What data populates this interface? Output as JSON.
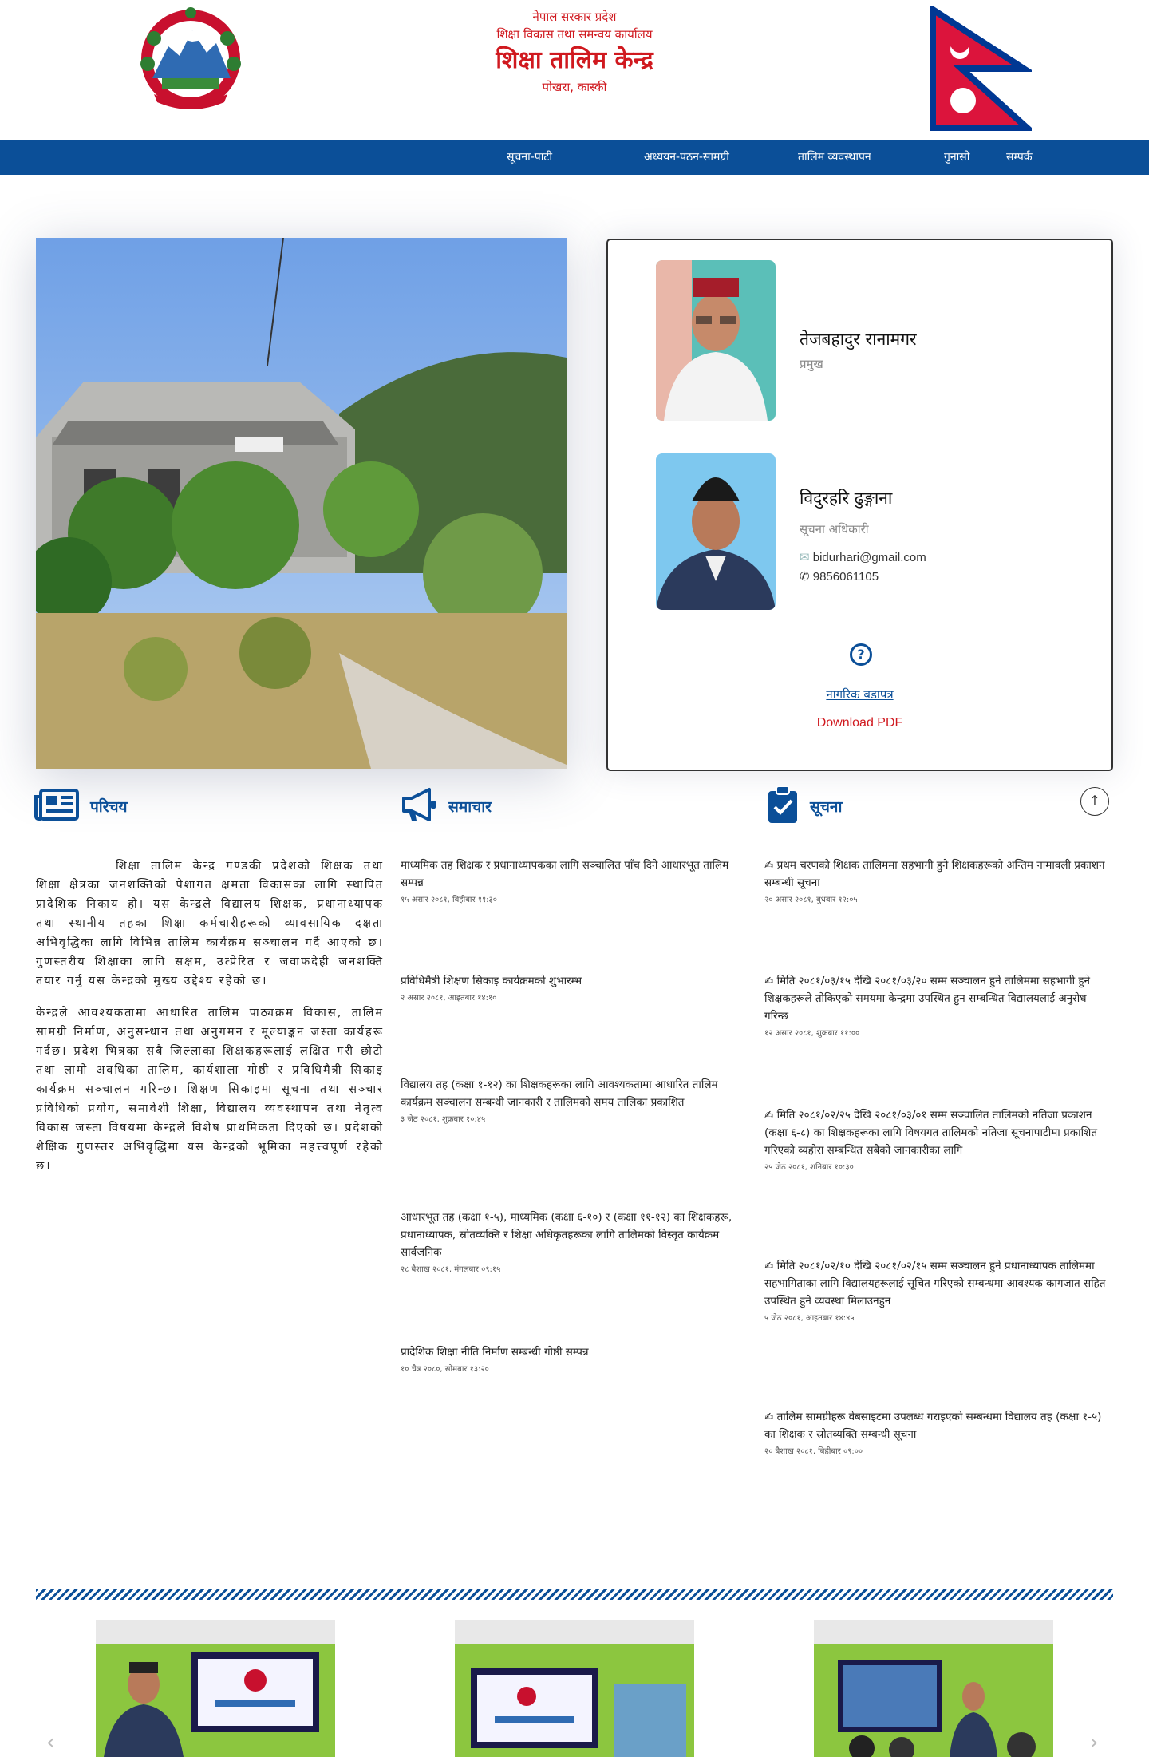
{
  "header": {
    "line1": "नेपाल सरकार प्रदेश",
    "line2": "शिक्षा विकास तथा समन्वय कार्यालय",
    "title": "शिक्षा तालिम केन्द्र",
    "location": "पोखरा, कास्की",
    "emblem_icon": "nepal-emblem",
    "flag_icon": "nepal-flag",
    "colors": {
      "brand_red": "#d0191f",
      "nav_blue": "#0b4f98"
    }
  },
  "nav": {
    "items": [
      {
        "label": "सूचना-पाटी"
      },
      {
        "label": "अध्ययन-पठन-सामग्री"
      },
      {
        "label": "तालिम व्यवस्थापन"
      },
      {
        "label": "गुनासो"
      },
      {
        "label": "सम्पर्क"
      }
    ]
  },
  "staff": {
    "members": [
      {
        "name": "तेजबहादुर रानामगर",
        "role": "प्रमुख"
      },
      {
        "name": "विदुरहरि ढुङ्गाना",
        "role": "सूचना अधिकारी",
        "email": "bidurhari@gmail.com",
        "phone": "9856061105",
        "email_icon": "envelope-icon",
        "phone_icon": "phone-icon"
      }
    ],
    "citizen_charter": "नागरिक बडापत्र",
    "download": "Download PDF"
  },
  "sections": {
    "intro": {
      "title": "परिचय",
      "icon": "newspaper-icon"
    },
    "news": {
      "title": "समाचार",
      "icon": "megaphone-icon"
    },
    "notices": {
      "title": "सूचना",
      "icon": "clipboard-check-icon"
    }
  },
  "intro": {
    "p1": "शिक्षा तालिम केन्द्र गण्डकी प्रदेशको शिक्षक तथा शिक्षा क्षेत्रका जनशक्तिको पेशागत क्षमता विकासका लागि स्थापित प्रादेशिक निकाय हो। यस केन्द्रले विद्यालय शिक्षक, प्रधानाध्यापक तथा स्थानीय तहका शिक्षा कर्मचारीहरूको व्यावसायिक दक्षता अभिवृद्धिका लागि विभिन्न तालिम कार्यक्रम सञ्चालन गर्दै आएको छ। गुणस्तरीय शिक्षाका लागि सक्षम, उत्प्रेरित र जवाफदेही जनशक्ति तयार गर्नु यस केन्द्रको मुख्य उद्देश्य रहेको छ।",
    "p2": "केन्द्रले आवश्यकतामा आधारित तालिम पाठ्यक्रम विकास, तालिम सामग्री निर्माण, अनुसन्धान तथा अनुगमन र मूल्याङ्कन जस्ता कार्यहरू गर्दछ। प्रदेश भित्रका सबै जिल्लाका शिक्षकहरूलाई लक्षित गरी छोटो तथा लामो अवधिका तालिम, कार्यशाला गोष्ठी र प्रविधिमैत्री सिकाइ कार्यक्रम सञ्चालन गरिन्छ। शिक्षण सिकाइमा सूचना तथा सञ्चार प्रविधिको प्रयोग, समावेशी शिक्षा, विद्यालय व्यवस्थापन तथा नेतृत्व विकास जस्ता विषयमा केन्द्रले विशेष प्राथमिकता दिएको छ। प्रदेशको शैक्षिक गुणस्तर अभिवृद्धिमा यस केन्द्रको भूमिका महत्त्वपूर्ण रहेको छ।"
  },
  "news": [
    {
      "title": "माध्यमिक तह शिक्षक र प्रधानाध्यापकका लागि सञ्चालित पाँच दिने आधारभूत तालिम सम्पन्न",
      "date": "१५ असार २०८१, बिहीबार ११:३०"
    },
    {
      "title": "प्रविधिमैत्री शिक्षण सिकाइ कार्यक्रमको शुभारम्भ",
      "date": "२ असार २०८१, आइतबार १४:१०"
    },
    {
      "title": "विद्यालय तह (कक्षा १-१२) का शिक्षकहरूका लागि आवश्यकतामा आधारित तालिम कार्यक्रम सञ्चालन सम्बन्धी जानकारी र तालिमको समय तालिका प्रकाशित",
      "date": "३ जेठ २०८१, शुक्रबार १०:४५"
    },
    {
      "title": "आधारभूत तह (कक्षा १-५), माध्यमिक (कक्षा ६-१०) र (कक्षा ११-१२) का शिक्षकहरू, प्रधानाध्यापक, स्रोतव्यक्ति र शिक्षा अधिकृतहरूका लागि तालिमको विस्तृत कार्यक्रम सार्वजनिक",
      "date": "२८ बैशाख २०८१, मंगलबार ०९:१५"
    },
    {
      "title": "प्रादेशिक शिक्षा नीति निर्माण सम्बन्धी गोष्ठी सम्पन्न",
      "date": "१० चैत्र २०८०, सोमबार १३:२०"
    }
  ],
  "notices": [
    {
      "title": "✍ प्रथम चरणको शिक्षक तालिममा सहभागी हुने शिक्षकहरूको अन्तिम नामावली प्रकाशन सम्बन्धी सूचना",
      "date": "२० असार २०८१, बुधबार १२:०५"
    },
    {
      "title": "✍ मिति २०८१/०३/१५ देखि २०८१/०३/२० सम्म सञ्चालन हुने तालिममा सहभागी हुने शिक्षकहरूले तोकिएको समयमा केन्द्रमा उपस्थित हुन सम्बन्धित विद्यालयलाई अनुरोध गरिन्छ",
      "date": "१२ असार २०८१, शुक्रबार ११:००"
    },
    {
      "title": "✍ मिति २०८१/०२/२५ देखि २०८१/०३/०१ सम्म सञ्चालित तालिमको नतिजा प्रकाशन (कक्षा ६-८) का शिक्षकहरूका लागि विषयगत तालिमको नतिजा सूचनापाटीमा प्रकाशित गरिएको व्यहोरा सम्बन्धित सबैको जानकारीका लागि",
      "date": "२५ जेठ २०८१, शनिबार १०:३०"
    },
    {
      "title": "✍ मिति २०८१/०२/१० देखि २०८१/०२/१५ सम्म सञ्चालन हुने प्रधानाध्यापक तालिममा सहभागिताका लागि विद्यालयहरूलाई सूचित गरिएको सम्बन्धमा आवश्यक कागजात सहित उपस्थित हुने व्यवस्था मिलाउनहुन",
      "date": "५ जेठ २०८१, आइतबार १४:४५"
    },
    {
      "title": "✍ तालिम सामग्रीहरू वेबसाइटमा उपलब्ध गराइएको सम्बन्धमा विद्यालय तह (कक्षा १-५) का शिक्षक र स्रोतव्यक्ति सम्बन्धी सूचना",
      "date": "२० बैशाख २०८१, बिहीबार ०९:००"
    }
  ]
}
